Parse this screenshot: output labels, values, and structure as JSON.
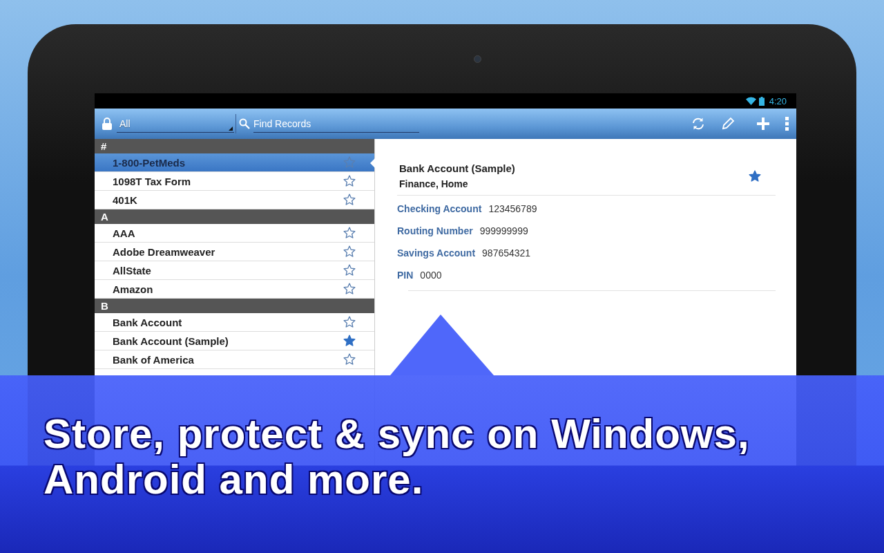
{
  "status_bar": {
    "time": "4:20"
  },
  "action_bar": {
    "category": "All",
    "search": {
      "placeholder": "Find Records"
    }
  },
  "list": {
    "sections": [
      {
        "header": "#",
        "items": [
          {
            "name": "1-800-PetMeds",
            "starred": false,
            "selected": true
          },
          {
            "name": "1098T Tax Form",
            "starred": false,
            "selected": false
          },
          {
            "name": "401K",
            "starred": false,
            "selected": false
          }
        ]
      },
      {
        "header": "A",
        "items": [
          {
            "name": "AAA",
            "starred": false,
            "selected": false
          },
          {
            "name": "Adobe Dreamweaver",
            "starred": false,
            "selected": false
          },
          {
            "name": "AllState",
            "starred": false,
            "selected": false
          },
          {
            "name": "Amazon",
            "starred": false,
            "selected": false
          }
        ]
      },
      {
        "header": "B",
        "items": [
          {
            "name": "Bank Account",
            "starred": false,
            "selected": false
          },
          {
            "name": "Bank Account (Sample)",
            "starred": true,
            "selected": false
          },
          {
            "name": "Bank of America",
            "starred": false,
            "selected": false
          }
        ]
      }
    ]
  },
  "detail": {
    "title": "Bank Account (Sample)",
    "tags": "Finance, Home",
    "starred": true,
    "fields": [
      {
        "label": "Checking Account",
        "value": "123456789"
      },
      {
        "label": "Routing Number",
        "value": "999999999"
      },
      {
        "label": "Savings Account",
        "value": "987654321"
      },
      {
        "label": "PIN",
        "value": "0000"
      }
    ]
  },
  "banner": {
    "lines": [
      "Store, protect & sync on Windows,",
      "Android and more."
    ]
  }
}
